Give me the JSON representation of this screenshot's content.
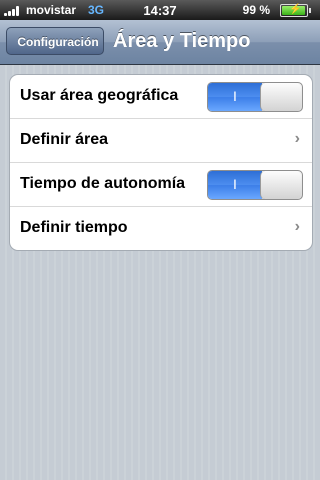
{
  "status_bar": {
    "carrier": "movistar",
    "network": "3G",
    "time": "14:37",
    "battery_percent": "99 %",
    "battery_level": 0.99,
    "signal_bars": 4
  },
  "nav_bar": {
    "back_label": "Configuración",
    "title": "Área y Tiempo"
  },
  "settings": {
    "rows": [
      {
        "label": "Usar área geográfica",
        "type": "toggle",
        "value": true,
        "toggle_text": "I"
      },
      {
        "label": "Definir área",
        "type": "disclosure"
      },
      {
        "label": "Tiempo de autonomía",
        "type": "toggle",
        "value": true,
        "toggle_text": "I"
      },
      {
        "label": "Definir tiempo",
        "type": "disclosure"
      }
    ]
  },
  "colors": {
    "nav_bar": "#7b8fab",
    "toggle_on": "#3c7ee8",
    "background": "#c5ccd4"
  }
}
